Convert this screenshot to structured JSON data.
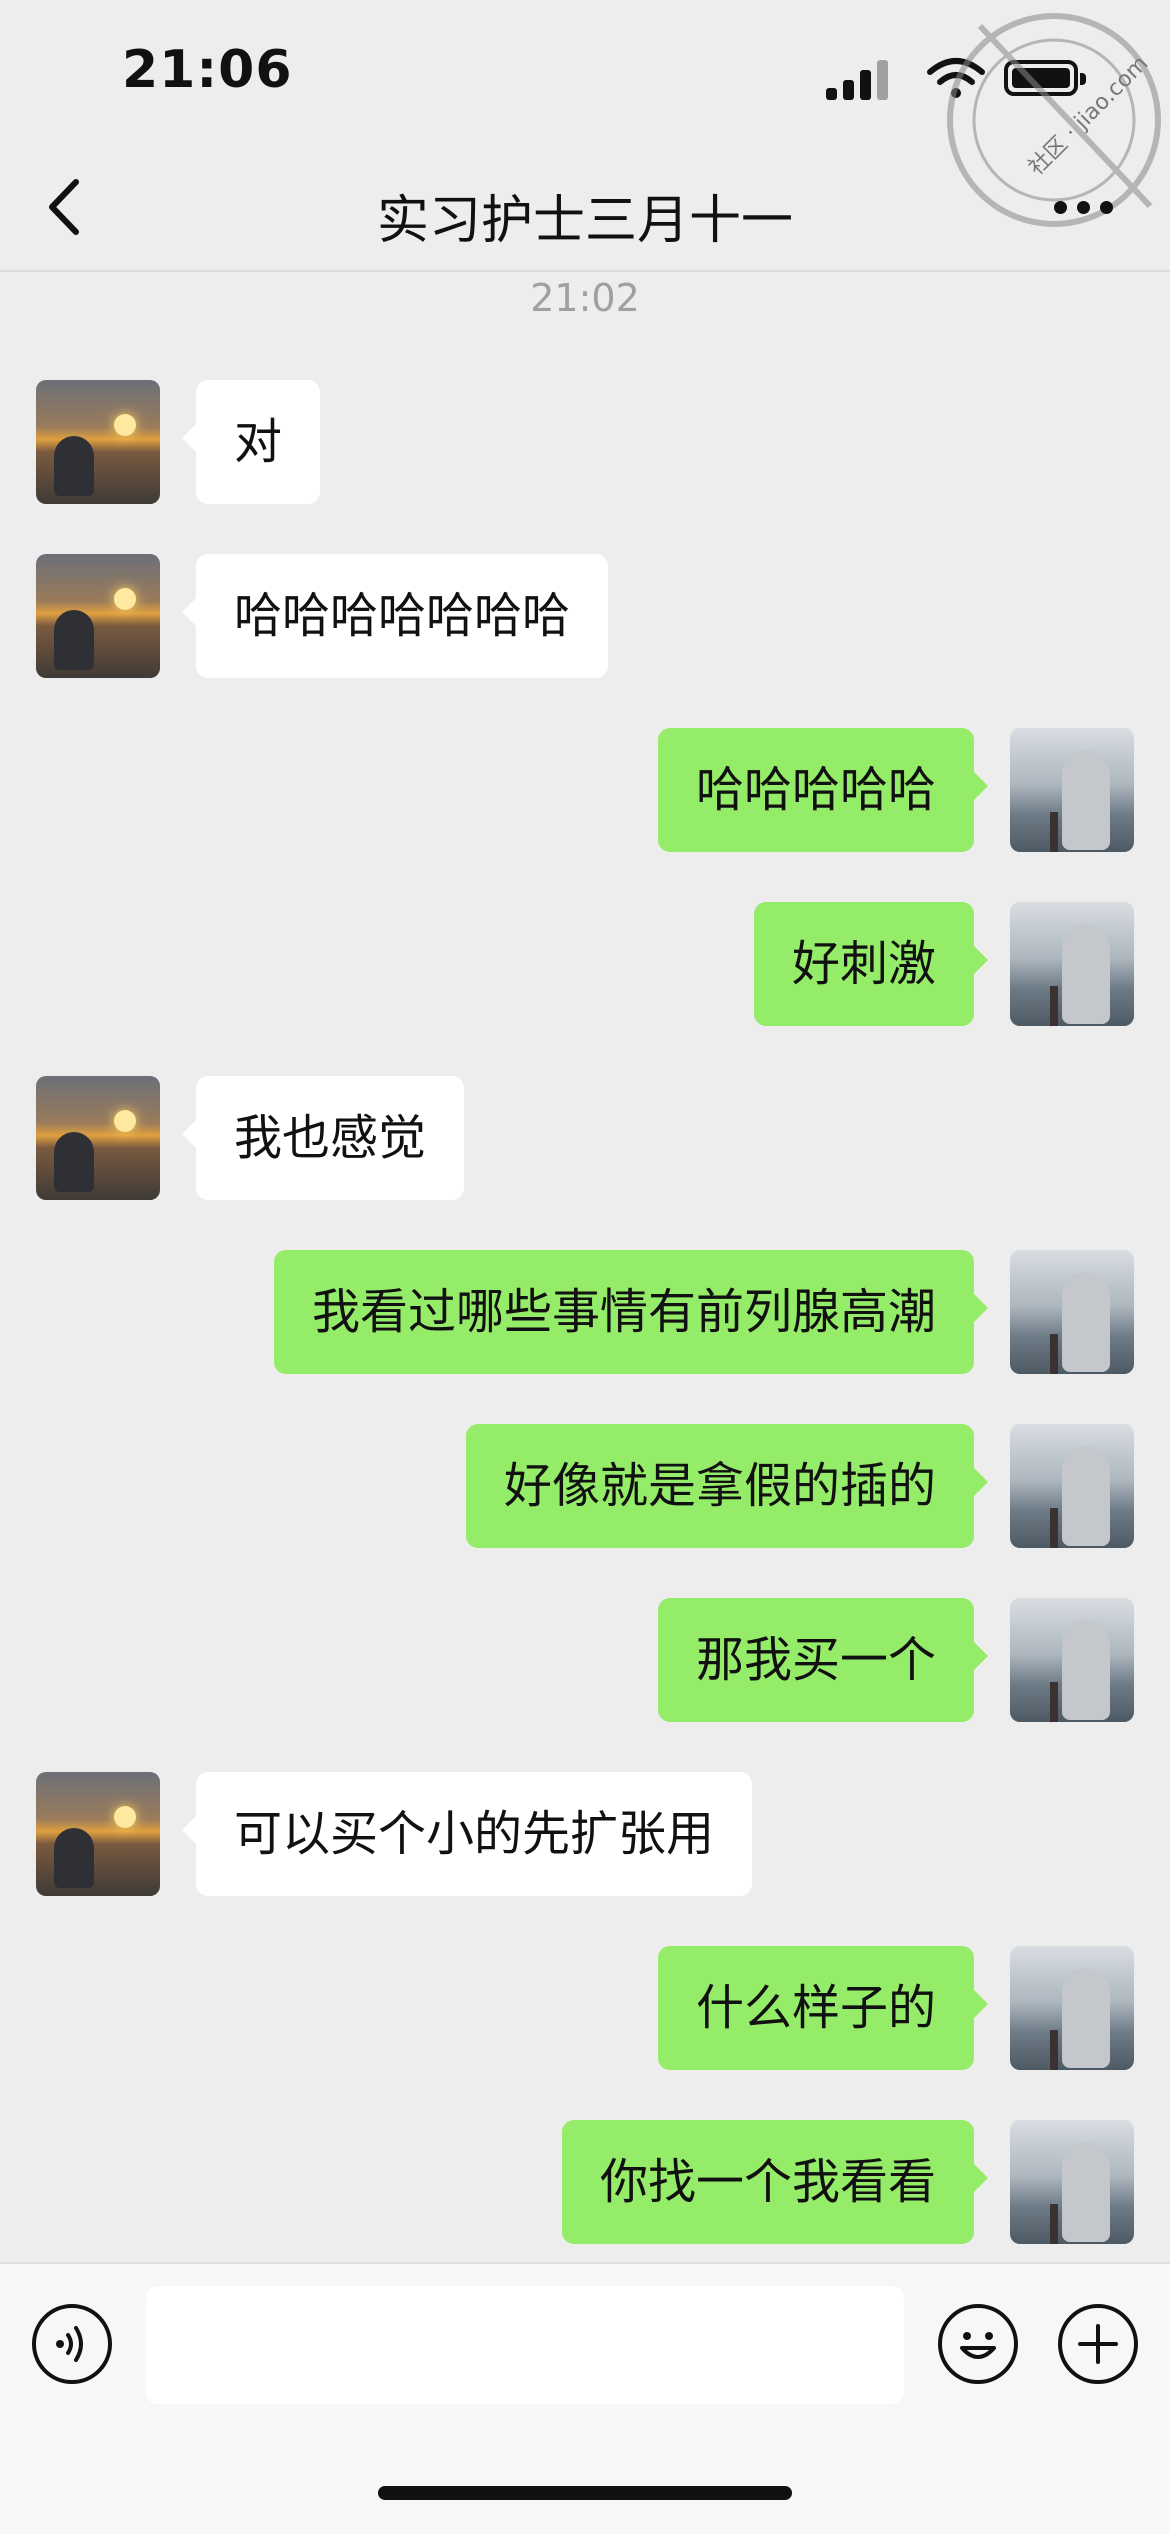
{
  "status_bar": {
    "time": "21:06",
    "signal_icon": "cellular-signal-icon",
    "wifi_icon": "wifi-icon",
    "battery_icon": "battery-icon"
  },
  "watermark": {
    "text": "社区 · jiao.com"
  },
  "nav": {
    "title": "实习护士三月十一",
    "back_icon": "chevron-left-icon",
    "more_icon": "more-dots-icon"
  },
  "chat": {
    "timestamp": "21:02",
    "messages": [
      {
        "direction": "in",
        "text": "对"
      },
      {
        "direction": "in",
        "text": "哈哈哈哈哈哈哈"
      },
      {
        "direction": "out",
        "text": "哈哈哈哈哈"
      },
      {
        "direction": "out",
        "text": "好刺激"
      },
      {
        "direction": "in",
        "text": "我也感觉"
      },
      {
        "direction": "out",
        "text": "我看过哪些事情有前列腺高潮"
      },
      {
        "direction": "out",
        "text": "好像就是拿假的插的"
      },
      {
        "direction": "out",
        "text": "那我买一个"
      },
      {
        "direction": "in",
        "text": "可以买个小的先扩张用"
      },
      {
        "direction": "out",
        "text": "什么样子的"
      },
      {
        "direction": "out",
        "text": "你找一个我看看"
      }
    ]
  },
  "input_bar": {
    "voice_icon": "voice-icon",
    "input_value": "",
    "emoji_icon": "emoji-icon",
    "plus_icon": "plus-icon"
  },
  "colors": {
    "background": "#ededed",
    "incoming_bubble": "#ffffff",
    "outgoing_bubble": "#95ec69",
    "timestamp_text": "#a0a0a0"
  }
}
